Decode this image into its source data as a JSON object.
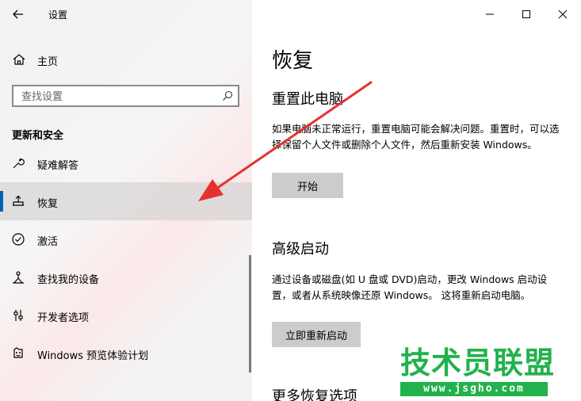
{
  "window": {
    "app_title": "设置",
    "controls": {
      "minimize": "minimize-icon",
      "maximize": "maximize-icon",
      "close": "close-icon"
    }
  },
  "sidebar": {
    "home_label": "主页",
    "search_placeholder": "查找设置",
    "section_title": "更新和安全",
    "items": [
      {
        "label": "疑难解答",
        "icon": "wrench-icon"
      },
      {
        "label": "恢复",
        "icon": "recovery-icon",
        "selected": true
      },
      {
        "label": "激活",
        "icon": "activation-check-icon"
      },
      {
        "label": "查找我的设备",
        "icon": "find-device-icon"
      },
      {
        "label": "开发者选项",
        "icon": "developer-icon"
      },
      {
        "label": "Windows 预览体验计划",
        "icon": "insider-icon"
      }
    ]
  },
  "main": {
    "page_title": "恢复",
    "reset": {
      "heading": "重置此电脑",
      "description": "如果电脑未正常运行，重置电脑可能会解决问题。重置时，可以选择保留个人文件或删除个人文件，然后重新安装 Windows。",
      "button": "开始"
    },
    "advanced": {
      "heading": "高级启动",
      "description": "通过设备或磁盘(如 U 盘或 DVD)启动，更改 Windows 启动设置，或者从系统映像还原 Windows。 这将重新启动电脑。",
      "button": "立即重新启动"
    },
    "more": {
      "heading": "更多恢复选项"
    }
  },
  "watermark": {
    "main": "技术员联盟",
    "sub": "www.jsgho.com"
  },
  "colors": {
    "accent": "#0063b1",
    "arrow": "#e5322d",
    "watermark": "#22b24c"
  }
}
